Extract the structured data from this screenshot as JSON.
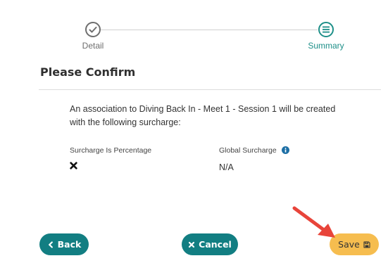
{
  "stepper": {
    "steps": [
      {
        "label": "Detail",
        "icon": "check-circle-icon",
        "state": "completed"
      },
      {
        "label": "Summary",
        "icon": "list-circle-icon",
        "state": "active"
      }
    ]
  },
  "title": "Please Confirm",
  "message": "An association to Diving Back In - Meet 1 - Session 1 will be created with the following surcharge:",
  "fields": {
    "surcharge_percentage": {
      "label": "Surcharge Is Percentage",
      "value_icon": "x-mark-icon"
    },
    "global_surcharge": {
      "label": "Global Surcharge",
      "info_icon": "info-icon",
      "value": "N/A"
    }
  },
  "buttons": {
    "back": {
      "label": "Back",
      "icon": "chevron-left-icon"
    },
    "cancel": {
      "label": "Cancel",
      "icon": "x-icon"
    },
    "save": {
      "label": "Save",
      "icon": "floppy-disk-icon"
    }
  },
  "colors": {
    "accent": "#127e82",
    "accent_text": "#1d8f88",
    "save_button": "#f6bd4f",
    "annotation_arrow": "#e8443a"
  }
}
